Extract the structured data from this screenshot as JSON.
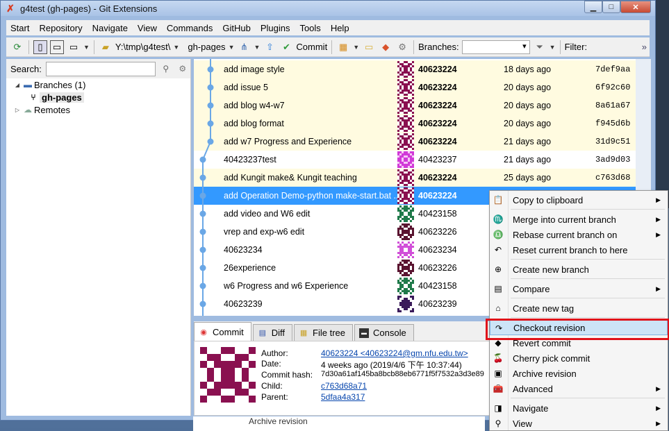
{
  "window": {
    "title": "g4test (gh-pages) - Git Extensions",
    "controls": {
      "minimize": "▁",
      "maximize": "□",
      "close": "✕"
    }
  },
  "menubar": [
    "Start",
    "Repository",
    "Navigate",
    "View",
    "Commands",
    "GitHub",
    "Plugins",
    "Tools",
    "Help"
  ],
  "toolbar": {
    "path": "Y:\\tmp\\g4test\\",
    "branch": "gh-pages",
    "commit_label": "Commit",
    "branches_label": "Branches:",
    "filter_label": "Filter:",
    "overflow": "»"
  },
  "left": {
    "search_label": "Search:",
    "branches_node": "Branches (1)",
    "current_branch": "gh-pages",
    "remotes_node": "Remotes"
  },
  "commits": [
    {
      "message": "add image style",
      "author": "40623224",
      "date": "18 days ago",
      "hash": "7def9aa",
      "style": "yellow",
      "bold": true,
      "avatar": "a"
    },
    {
      "message": "add issue 5",
      "author": "40623224",
      "date": "20 days ago",
      "hash": "6f92c60",
      "style": "yellow",
      "bold": true,
      "avatar": "a"
    },
    {
      "message": "add blog w4-w7",
      "author": "40623224",
      "date": "20 days ago",
      "hash": "8a61a67",
      "style": "yellow",
      "bold": true,
      "avatar": "a"
    },
    {
      "message": "add blog format",
      "author": "40623224",
      "date": "20 days ago",
      "hash": "f945d6b",
      "style": "yellow",
      "bold": true,
      "avatar": "a"
    },
    {
      "message": "add w7 Progress and Experience",
      "author": "40623224",
      "date": "21 days ago",
      "hash": "31d9c51",
      "style": "yellow",
      "bold": true,
      "avatar": "a"
    },
    {
      "message": "40423237test",
      "author": "40423237",
      "date": "21 days ago",
      "hash": "3ad9d03",
      "style": "white",
      "bold": false,
      "avatar": "b"
    },
    {
      "message": "add Kungit make& Kungit teaching",
      "author": "40623224",
      "date": "25 days ago",
      "hash": "c763d68",
      "style": "yellow",
      "bold": true,
      "avatar": "a"
    },
    {
      "message": "add Operation Demo-python make-start.bat ...",
      "author": "40623224",
      "date": "",
      "hash": "",
      "style": "selected",
      "bold": true,
      "avatar": "a"
    },
    {
      "message": "add video and W6 edit",
      "author": "40423158",
      "date": "",
      "hash": "",
      "style": "white",
      "bold": false,
      "avatar": "c"
    },
    {
      "message": "vrep and exp-w6 edit",
      "author": "40623226",
      "date": "",
      "hash": "",
      "style": "white",
      "bold": false,
      "avatar": "d"
    },
    {
      "message": "40623234",
      "author": "40623234",
      "date": "",
      "hash": "",
      "style": "white",
      "bold": false,
      "avatar": "e"
    },
    {
      "message": "26experience",
      "author": "40623226",
      "date": "",
      "hash": "",
      "style": "white",
      "bold": false,
      "avatar": "d"
    },
    {
      "message": "w6 Progress and w6 Experience",
      "author": "40423158",
      "date": "",
      "hash": "",
      "style": "white",
      "bold": false,
      "avatar": "c"
    },
    {
      "message": "40623239",
      "author": "40623239",
      "date": "",
      "hash": "",
      "style": "white",
      "bold": false,
      "avatar": "f"
    }
  ],
  "tabs": [
    "Commit",
    "Diff",
    "File tree",
    "Console"
  ],
  "details": {
    "author_label": "Author:",
    "author_value": "40623224 <40623224@gm.nfu.edu.tw>",
    "date_label": "Date:",
    "date_value": "4 weeks ago (2019/4/6 下午 10:37:44)",
    "hash_label": "Commit hash:",
    "hash_value": "7d30a61af145ba8bcb88eb6771f5f7532a3d3e89",
    "child_label": "Child:",
    "child_value": "c763d68a71",
    "parent_label": "Parent:",
    "parent_value": "5dfaa4a317",
    "below_text": "Archive revision"
  },
  "context_menu": [
    {
      "label": "Copy to clipboard",
      "icon": "clipboard-icon",
      "glyph": "📋",
      "submenu": true
    },
    {
      "sep": true
    },
    {
      "label": "Merge into current branch",
      "icon": "merge-icon",
      "glyph": "♏",
      "submenu": true
    },
    {
      "label": "Rebase current branch on",
      "icon": "rebase-icon",
      "glyph": "♎",
      "submenu": true
    },
    {
      "label": "Reset current branch to here",
      "icon": "reset-icon",
      "glyph": "↶",
      "submenu": false
    },
    {
      "sep": true
    },
    {
      "label": "Create new branch",
      "icon": "new-branch-icon",
      "glyph": "⊕",
      "submenu": false
    },
    {
      "sep": true
    },
    {
      "label": "Compare",
      "icon": "compare-icon",
      "glyph": "▤",
      "submenu": true
    },
    {
      "sep": true
    },
    {
      "label": "Create new tag",
      "icon": "tag-icon",
      "glyph": "⌂",
      "submenu": false
    },
    {
      "sep": true
    },
    {
      "label": "Checkout revision",
      "icon": "checkout-icon",
      "glyph": "↷",
      "submenu": false,
      "highlight": true
    },
    {
      "label": "Revert commit",
      "icon": "revert-icon",
      "glyph": "◆",
      "submenu": false
    },
    {
      "label": "Cherry pick commit",
      "icon": "cherry-icon",
      "glyph": "🍒",
      "submenu": false
    },
    {
      "label": "Archive revision",
      "icon": "archive-icon",
      "glyph": "▣",
      "submenu": false
    },
    {
      "label": "Advanced",
      "icon": "toolbox-icon",
      "glyph": "🧰",
      "submenu": true
    },
    {
      "sep": true
    },
    {
      "label": "Navigate",
      "icon": "navigate-icon",
      "glyph": "◨",
      "submenu": true
    },
    {
      "label": "View",
      "icon": "view-icon",
      "glyph": "⚲",
      "submenu": true
    }
  ],
  "colors": {
    "selected_row": "#3399ff",
    "unpushed_row": "#fffbe0",
    "graph_line": "#6aa7e6",
    "highlight_box": "#e0121a"
  }
}
